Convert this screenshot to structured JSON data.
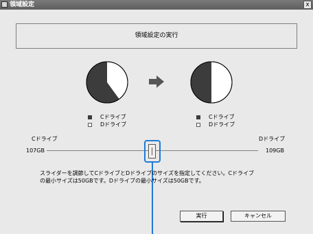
{
  "window": {
    "title": "領域設定",
    "close_label": "x"
  },
  "header": {
    "label": "領域設定の実行"
  },
  "before_pie": {
    "c_drive_fraction": 0.6,
    "legend": [
      {
        "swatch": "dark",
        "label": "Cドライブ"
      },
      {
        "swatch": "light",
        "label": "Dドライブ"
      }
    ]
  },
  "after_pie": {
    "c_drive_fraction": 0.5,
    "legend": [
      {
        "swatch": "dark",
        "label": "Cドライブ"
      },
      {
        "swatch": "light",
        "label": "Dドライブ"
      }
    ]
  },
  "slider": {
    "left_label": "Cドライブ",
    "right_label": "Dドライブ",
    "left_value": "107GB",
    "right_value": "109GB",
    "position_fraction": 0.5
  },
  "description": "スライダーを調節してCドライブとDドライブのサイズを指定してください。Cドライブの最小サイズは50GBです。Dドライブの最小サイズは50GBです。",
  "buttons": {
    "execute": "実行",
    "cancel": "キャンセル"
  },
  "colors": {
    "dark": "#3c3c3c",
    "light": "#ffffff",
    "highlight": "#1e7ad6"
  }
}
